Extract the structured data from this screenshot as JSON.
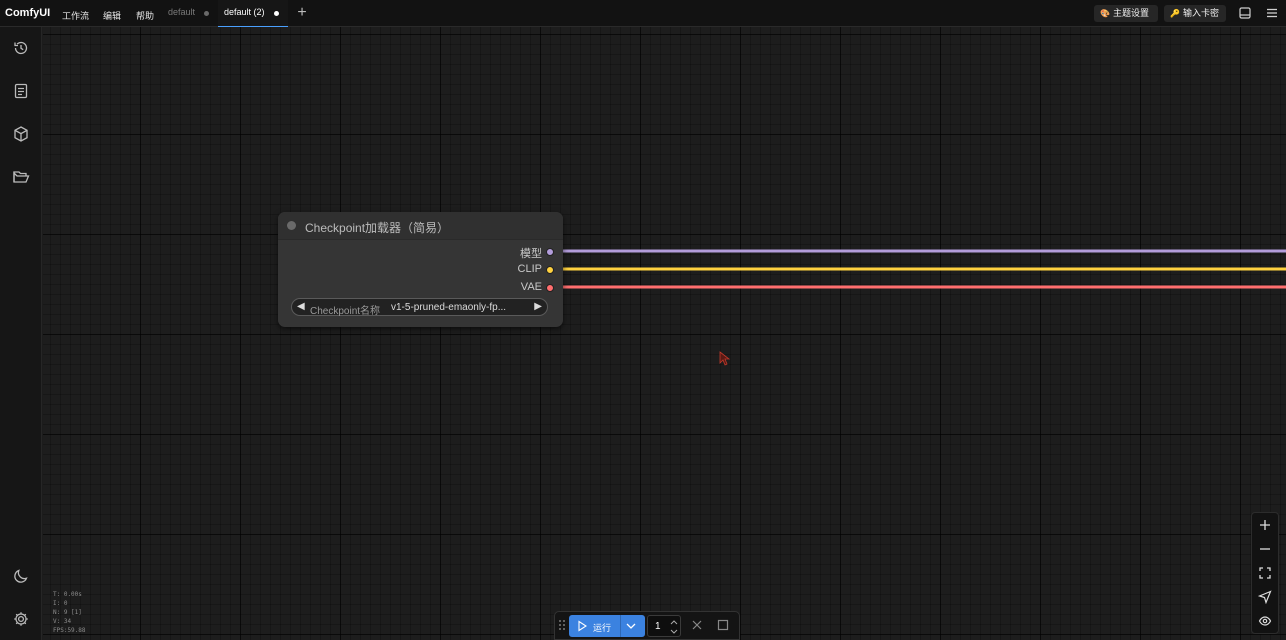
{
  "app": {
    "brand": "ComfyUI"
  },
  "menu": {
    "items": [
      "工作流",
      "编辑",
      "帮助"
    ]
  },
  "tabs": [
    {
      "label": "default",
      "active": false
    },
    {
      "label": "default (2)",
      "active": true
    }
  ],
  "top_buttons": {
    "theme": "主题设置",
    "key": "输入卡密"
  },
  "node": {
    "title": "Checkpoint加载器（简易）",
    "outputs": [
      {
        "label": "模型",
        "color": "#b39ddb"
      },
      {
        "label": "CLIP",
        "color": "#ffd23f"
      },
      {
        "label": "VAE",
        "color": "#ff6e6e"
      }
    ],
    "widget": {
      "label": "Checkpoint名称",
      "value": "v1-5-pruned-emaonly-fp..."
    }
  },
  "stats": {
    "t": "T: 0.00s",
    "i": "I: 0",
    "n": "N: 9 [1]",
    "v": "V: 34",
    "fps": "FPS:59.88"
  },
  "run_toolbar": {
    "run_label": "运行",
    "count": "1"
  },
  "colors": {
    "accent": "#3b82e0",
    "background": "#1c1c1c"
  },
  "icons": {
    "sidebar": [
      "history-icon",
      "queue-list-icon",
      "model-library-cube-icon",
      "workflows-folder-icon",
      "theme-moon-icon",
      "settings-gear-icon"
    ],
    "zoom": [
      "zoom-in-icon",
      "zoom-out-icon",
      "fit-view-icon",
      "focus-icon",
      "toggle-links-eye-icon"
    ]
  }
}
